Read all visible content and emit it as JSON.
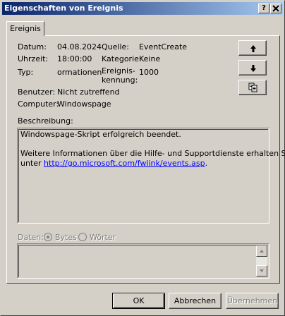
{
  "window": {
    "title": "Eigenschaften von Ereignis",
    "help_button": "?",
    "close_button": "X"
  },
  "tabs": [
    {
      "label": "Ereignis"
    }
  ],
  "event": {
    "date_label": "Datum:",
    "date_value": "04.08.2024",
    "time_label": "Uhrzeit:",
    "time_value": "18:00:00",
    "type_label": "Typ:",
    "type_value": "ormationen",
    "user_label": "Benutzer:",
    "user_value": "Nicht zutreffend",
    "computer_label": "Computer:",
    "computer_value": "Windowspage",
    "source_label": "Quelle:",
    "source_value": "EventCreate",
    "category_label": "Kategorie:",
    "category_value": "Keine",
    "id_label_line1": "Ereignis-",
    "id_label_line2": "kennung:",
    "id_value": "1000"
  },
  "description": {
    "label": "Beschreibung:",
    "line1": "Windowspage-Skript erfolgreich beendet.",
    "line2": "Weitere Informationen über die Hilfe- und Supportdienste erhalten Sie",
    "line3_prefix": "unter",
    "link": "http://go.microsoft.com/fwlink/events.asp",
    "line3_suffix": "."
  },
  "data_section": {
    "label": "Daten:",
    "bytes_label": "Bytes",
    "words_label": "Wörter",
    "selected": "Bytes"
  },
  "nav_buttons": {
    "up_icon": "arrow-up-icon",
    "down_icon": "arrow-down-icon",
    "copy_icon": "copy-icon"
  },
  "footer": {
    "ok_label": "OK",
    "cancel_label": "Abbrechen",
    "apply_label": "Übernehmen"
  }
}
